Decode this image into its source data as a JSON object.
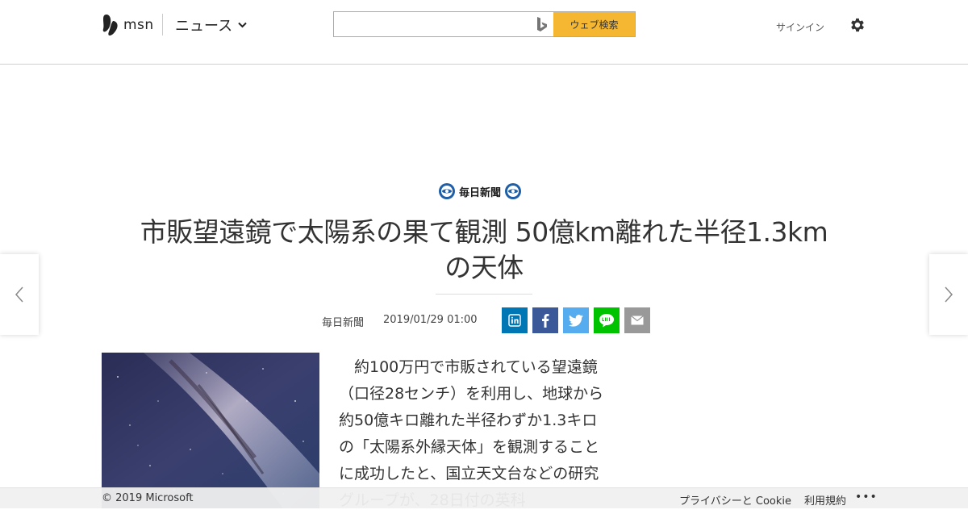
{
  "header": {
    "logo_text": "msn",
    "section_label": "ニュース",
    "search_placeholder": "",
    "search_button": "ウェブ検索",
    "signin_label": "サインイン"
  },
  "article": {
    "source_logo_text": "毎日新聞",
    "title_line1": "市販望遠鏡で太陽系の果て観測 50億km離れた半径1.3km",
    "title_line2": "の天体",
    "byline_source": "毎日新聞",
    "byline_date": "2019/01/29 01:00",
    "body": "　約100万円で市販されている望遠鏡（口径28センチ）を利用し、地球から約50億キロ離れた半径わずか1.3キロの「太陽系外縁天体」を観測することに成功したと、国立天文台などの研究グループが、28日付の英科"
  },
  "share_buttons": [
    {
      "name": "linkedin",
      "color": "#0077b5"
    },
    {
      "name": "facebook",
      "color": "#3b5998"
    },
    {
      "name": "twitter",
      "color": "#55acee"
    },
    {
      "name": "line",
      "color": "#00c300"
    },
    {
      "name": "mail",
      "color": "#999999"
    }
  ],
  "footer": {
    "copyright": "© 2019 Microsoft",
    "privacy": "プライバシーと Cookie",
    "terms": "利用規約",
    "more": "•••"
  },
  "colors": {
    "search_button": "#f5b731",
    "accent": "#333333"
  }
}
